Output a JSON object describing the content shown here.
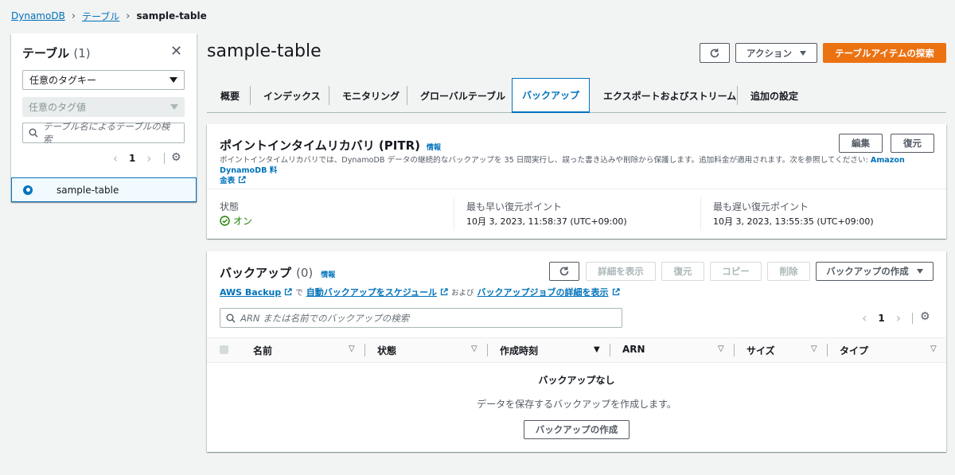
{
  "breadcrumb": {
    "home": "DynamoDB",
    "section": "テーブル",
    "current": "sample-table"
  },
  "sidebar": {
    "title": "テーブル",
    "count": "(1)",
    "tag_key_select": "任意のタグキー",
    "tag_value_select": "任意のタグ値",
    "search_placeholder": "テーブル名によるテーブルの検索",
    "page": "1",
    "tables": [
      {
        "name": "sample-table",
        "selected": true
      }
    ]
  },
  "header": {
    "title": "sample-table",
    "actions_label": "アクション",
    "explore_label": "テーブルアイテムの探索"
  },
  "tabs": [
    {
      "label": "概要",
      "active": false
    },
    {
      "label": "インデックス",
      "active": false
    },
    {
      "label": "モニタリング",
      "active": false
    },
    {
      "label": "グローバルテーブル",
      "active": false
    },
    {
      "label": "バックアップ",
      "active": true
    },
    {
      "label": "エクスポートおよびストリーム",
      "active": false
    },
    {
      "label": "追加の設定",
      "active": false
    }
  ],
  "pitr": {
    "title": "ポイントインタイムリカバリ (PITR)",
    "info": "情報",
    "edit_label": "編集",
    "restore_label": "復元",
    "description": "ポイントインタイムリカバリでは、DynamoDB データの継続的なバックアップを 35 日間実行し、誤った書き込みや削除から保護します。追加料金が適用されます。次を参照してください: ",
    "pricing_link_a": "Amazon DynamoDB 料",
    "pricing_link_b": "金表",
    "status_label": "状態",
    "status_value": "オン",
    "earliest_label": "最も早い復元ポイント",
    "earliest_value": "10月 3, 2023, 11:58:37 (UTC+09:00)",
    "latest_label": "最も遅い復元ポイント",
    "latest_value": "10月 3, 2023, 13:55:35 (UTC+09:00)"
  },
  "backups": {
    "title": "バックアップ",
    "count": "(0)",
    "info": "情報",
    "details_label": "詳細を表示",
    "restore_label": "復元",
    "copy_label": "コピー",
    "delete_label": "削除",
    "create_label": "バックアップの作成",
    "aws_backup_link": "AWS Backup",
    "text_de": "で",
    "schedule_link": "自動バックアップをスケジュール",
    "text_oyobi": "および",
    "jobs_link": "バックアップジョブの詳細を表示",
    "search_placeholder": "ARN または名前でのバックアップの検索",
    "page": "1",
    "columns": [
      "名前",
      "状態",
      "作成時刻",
      "ARN",
      "サイズ",
      "タイプ"
    ],
    "empty_title": "バックアップなし",
    "empty_desc": "データを保存するバックアップを作成します。",
    "empty_create_label": "バックアップの作成"
  }
}
